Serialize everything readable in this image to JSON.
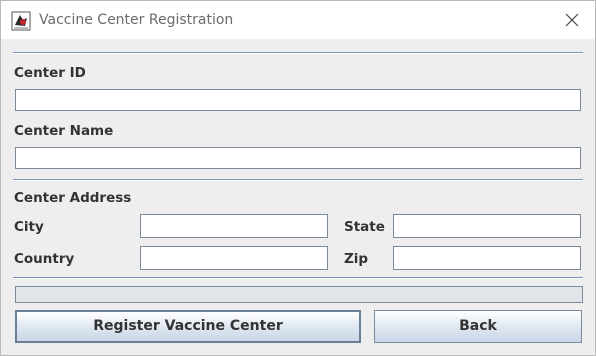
{
  "window": {
    "title": "Vaccine Center Registration",
    "app_icon": "java-duke-icon",
    "close_icon": "close-icon"
  },
  "form": {
    "center_id": {
      "label": "Center ID",
      "value": "",
      "placeholder": ""
    },
    "center_name": {
      "label": "Center Name",
      "value": "",
      "placeholder": ""
    },
    "address_heading": "Center Address",
    "city": {
      "label": "City",
      "value": ""
    },
    "state": {
      "label": "State",
      "value": ""
    },
    "country": {
      "label": "Country",
      "value": ""
    },
    "zip": {
      "label": "Zip",
      "value": ""
    }
  },
  "progress": {
    "fraction": 0
  },
  "buttons": {
    "register": "Register Vaccine Center",
    "back": "Back"
  },
  "colors": {
    "separator": "#7a93c1",
    "window_bg": "#eeeeee"
  }
}
